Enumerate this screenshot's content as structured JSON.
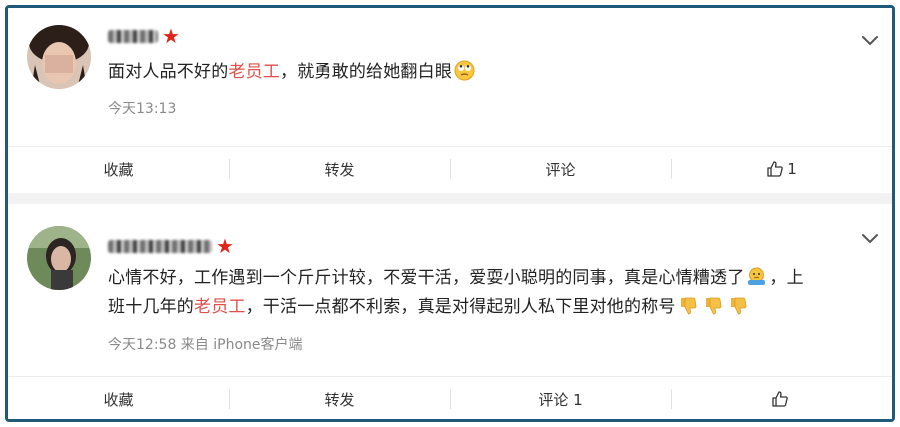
{
  "posts": [
    {
      "content_parts": [
        "面对人品不好的",
        "老员工",
        "，就勇敢的给她翻白眼"
      ],
      "time": "今天13:13",
      "actions": {
        "collect": "收藏",
        "repost": "转发",
        "comment": "评论",
        "like": "1"
      }
    },
    {
      "line1_parts": [
        "心情不好，工作遇到一个斤斤计较，不爱干活，爱耍小聪明的同事，真是心情糟透了",
        "，上"
      ],
      "line2_parts": [
        "班十几年的",
        "老员工",
        "，干活一点都不利索，真是对得起别人私下里对他的称号"
      ],
      "time": "今天12:58 来自 iPhone客户端",
      "actions": {
        "collect": "收藏",
        "repost": "转发",
        "comment": "评论 1",
        "like": ""
      }
    }
  ],
  "icons": [
    "star-icon",
    "chevron-down-icon",
    "eye-roll-emoji",
    "worried-emoji",
    "thumbs-down-emoji",
    "thumbs-up-icon"
  ],
  "colors": {
    "highlight": "#e0504a",
    "star": "#e1251b",
    "frame": "#1f5a7a"
  }
}
